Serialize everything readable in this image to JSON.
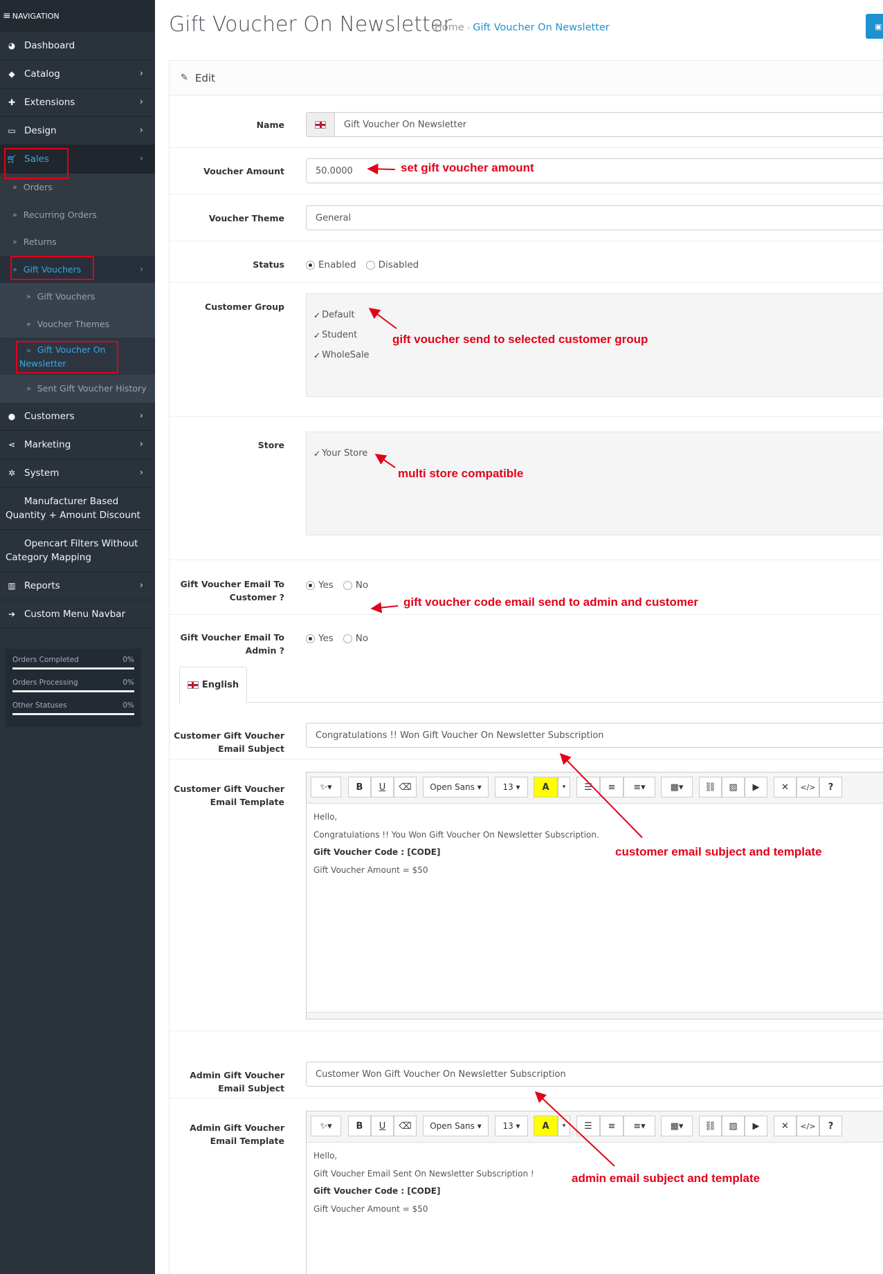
{
  "sidebar": {
    "header": "NAVIGATION",
    "items": [
      {
        "label": "Dashboard",
        "icon": "dashboard-icon"
      },
      {
        "label": "Catalog",
        "icon": "tags-icon"
      },
      {
        "label": "Extensions",
        "icon": "puzzle-icon"
      },
      {
        "label": "Design",
        "icon": "monitor-icon"
      },
      {
        "label": "Sales",
        "icon": "cart-icon"
      }
    ],
    "sales_sub": [
      "Orders",
      "Recurring Orders",
      "Returns",
      "Gift Vouchers"
    ],
    "vouchers_sub": [
      "Gift Vouchers",
      "Voucher Themes",
      "Gift Voucher On Newsletter",
      "Sent Gift Voucher History"
    ],
    "items2": [
      {
        "label": "Customers",
        "icon": "user-icon"
      },
      {
        "label": "Marketing",
        "icon": "share-icon"
      },
      {
        "label": "System",
        "icon": "gear-icon"
      },
      {
        "label": "Manufacturer Based Quantity + Amount Discount",
        "icon": "arrow-right-icon"
      },
      {
        "label": "Opencart Filters Without Category Mapping",
        "icon": "arrow-right-icon"
      },
      {
        "label": "Reports",
        "icon": "bar-chart-icon"
      },
      {
        "label": "Custom Menu Navbar",
        "icon": "arrow-right-icon"
      }
    ],
    "stats": [
      {
        "label": "Orders Completed",
        "value": "0%"
      },
      {
        "label": "Orders Processing",
        "value": "0%"
      },
      {
        "label": "Other Statuses",
        "value": "0%"
      }
    ]
  },
  "page": {
    "title": "Gift Voucher On Newsletter",
    "breadcrumb": [
      "Home",
      "Gift Voucher On Newsletter"
    ],
    "panel_title": "Edit"
  },
  "form": {
    "name_label": "Name",
    "name_value": "Gift Voucher On Newsletter",
    "amount_label": "Voucher Amount",
    "amount_value": "50.0000",
    "theme_label": "Voucher Theme",
    "theme_value": "General",
    "status_label": "Status",
    "status_options": [
      "Enabled",
      "Disabled"
    ],
    "status_selected": "Enabled",
    "group_label": "Customer Group",
    "groups": [
      "Default",
      "Student",
      "WholeSale"
    ],
    "store_label": "Store",
    "stores": [
      "Your Store"
    ],
    "email_customer_label": "Gift Voucher Email To Customer ?",
    "email_admin_label": "Gift Voucher Email To Admin ?",
    "yes": "Yes",
    "no": "No",
    "language_tab": "English",
    "cust_subject_label": "Customer Gift Voucher Email Subject",
    "cust_subject_value": "Congratulations !! Won Gift Voucher On Newsletter Subscription",
    "cust_template_label": "Customer Gift Voucher Email Template",
    "cust_template": [
      "Hello,",
      "Congratulations !! You Won Gift Voucher On Newsletter Subscription.",
      "Gift Voucher Code : [CODE]",
      "Gift Voucher Amount = $50"
    ],
    "admin_subject_label": "Admin Gift Voucher Email Subject",
    "admin_subject_value": "Customer Won Gift Voucher On Newsletter Subscription",
    "admin_template_label": "Admin Gift Voucher Email Template",
    "admin_template": [
      "Hello,",
      "Gift Voucher Email Sent On Newsletter Subscription !",
      "Gift Voucher Code : [CODE]",
      "Gift Voucher Amount = $50"
    ]
  },
  "toolbar": {
    "font": "Open Sans",
    "size": "13"
  },
  "annotations": {
    "amount": "set gift voucher amount",
    "group": "gift voucher send to selected customer group",
    "store": "multi store compatible",
    "email": "gift voucher code email send to admin and customer",
    "customer": "customer email subject and template",
    "admin": "admin email subject and template"
  },
  "colors": {
    "accent": "#1e91cf",
    "annotation": "#e3001b",
    "sidebar": "#2a323b"
  }
}
